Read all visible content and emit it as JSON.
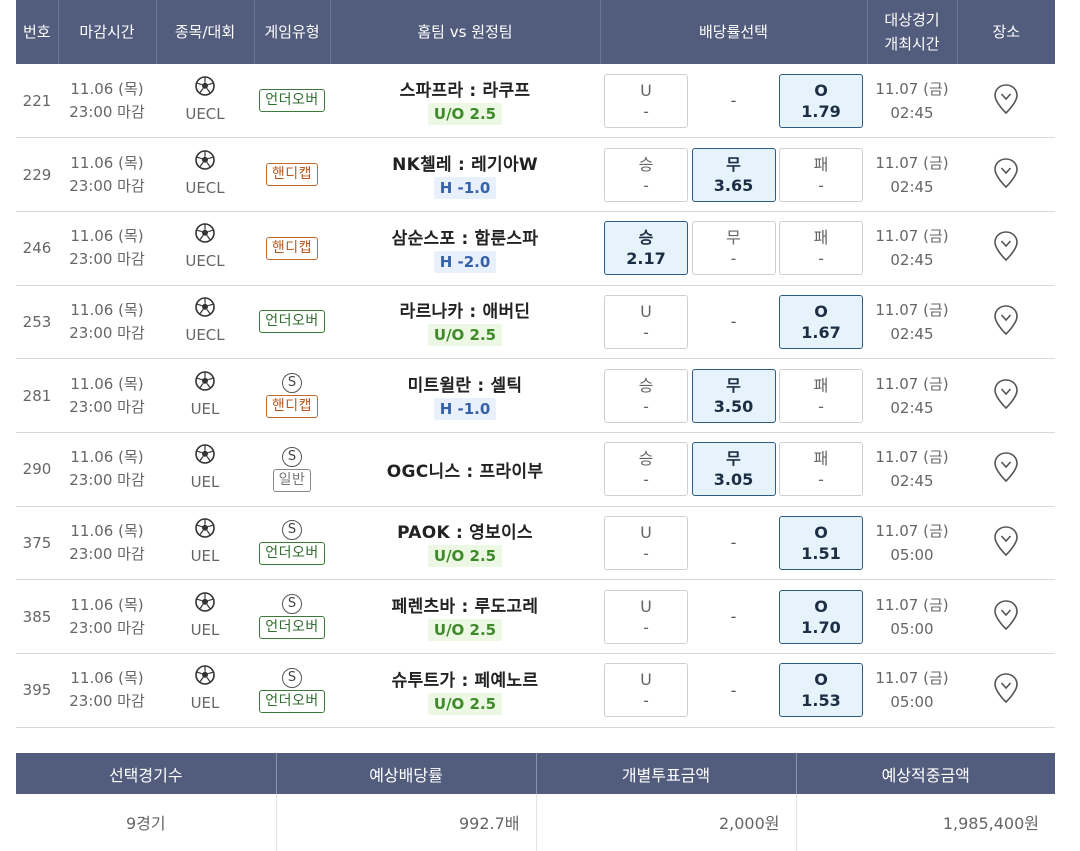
{
  "header": {
    "no": "번호",
    "deadline": "마감시간",
    "sport": "종목/대회",
    "type": "게임유형",
    "match": "홈팀 vs 원정팀",
    "odds": "배당률선택",
    "event_time_1": "대상경기",
    "event_time_2": "개최시간",
    "place": "장소"
  },
  "rows": [
    {
      "no": "221",
      "date": "11.06 (목)",
      "deadline": "23:00 마감",
      "league": "UECL",
      "s": "",
      "type": "언더오버",
      "type_kind": "uo",
      "home": "스파프라",
      "away": "라쿠프",
      "sub": "U/O 2.5",
      "sub_kind": "uo",
      "o1_label": "U",
      "o1_val": "-",
      "o2_label": "-",
      "o2_val": "",
      "o3_label": "O",
      "o3_val": "1.79",
      "sel": 3,
      "mid_dash": true,
      "evt_date": "11.07 (금)",
      "evt_time": "02:45"
    },
    {
      "no": "229",
      "date": "11.06 (목)",
      "deadline": "23:00 마감",
      "league": "UECL",
      "s": "",
      "type": "핸디캡",
      "type_kind": "hc",
      "home": "NK첼레",
      "away": "레기아W",
      "sub": "H -1.0",
      "sub_kind": "hc",
      "o1_label": "승",
      "o1_val": "-",
      "o2_label": "무",
      "o2_val": "3.65",
      "o3_label": "패",
      "o3_val": "-",
      "sel": 2,
      "mid_dash": false,
      "evt_date": "11.07 (금)",
      "evt_time": "02:45"
    },
    {
      "no": "246",
      "date": "11.06 (목)",
      "deadline": "23:00 마감",
      "league": "UECL",
      "s": "",
      "type": "핸디캡",
      "type_kind": "hc",
      "home": "삼순스포",
      "away": "함룬스파",
      "sub": "H -2.0",
      "sub_kind": "hc",
      "o1_label": "승",
      "o1_val": "2.17",
      "o2_label": "무",
      "o2_val": "-",
      "o3_label": "패",
      "o3_val": "-",
      "sel": 1,
      "mid_dash": false,
      "evt_date": "11.07 (금)",
      "evt_time": "02:45"
    },
    {
      "no": "253",
      "date": "11.06 (목)",
      "deadline": "23:00 마감",
      "league": "UECL",
      "s": "",
      "type": "언더오버",
      "type_kind": "uo",
      "home": "라르나카",
      "away": "애버딘",
      "sub": "U/O 2.5",
      "sub_kind": "uo",
      "o1_label": "U",
      "o1_val": "-",
      "o2_label": "-",
      "o2_val": "",
      "o3_label": "O",
      "o3_val": "1.67",
      "sel": 3,
      "mid_dash": true,
      "evt_date": "11.07 (금)",
      "evt_time": "02:45"
    },
    {
      "no": "281",
      "date": "11.06 (목)",
      "deadline": "23:00 마감",
      "league": "UEL",
      "s": "S",
      "type": "핸디캡",
      "type_kind": "hc",
      "home": "미트윌란",
      "away": "셀틱",
      "sub": "H -1.0",
      "sub_kind": "hc",
      "o1_label": "승",
      "o1_val": "-",
      "o2_label": "무",
      "o2_val": "3.50",
      "o3_label": "패",
      "o3_val": "-",
      "sel": 2,
      "mid_dash": false,
      "evt_date": "11.07 (금)",
      "evt_time": "02:45"
    },
    {
      "no": "290",
      "date": "11.06 (목)",
      "deadline": "23:00 마감",
      "league": "UEL",
      "s": "S",
      "type": "일반",
      "type_kind": "nm",
      "home": "OGC니스",
      "away": "프라이부",
      "sub": "",
      "sub_kind": "",
      "o1_label": "승",
      "o1_val": "-",
      "o2_label": "무",
      "o2_val": "3.05",
      "o3_label": "패",
      "o3_val": "-",
      "sel": 2,
      "mid_dash": false,
      "evt_date": "11.07 (금)",
      "evt_time": "02:45"
    },
    {
      "no": "375",
      "date": "11.06 (목)",
      "deadline": "23:00 마감",
      "league": "UEL",
      "s": "S",
      "type": "언더오버",
      "type_kind": "uo",
      "home": "PAOK",
      "away": "영보이스",
      "sub": "U/O 2.5",
      "sub_kind": "uo",
      "o1_label": "U",
      "o1_val": "-",
      "o2_label": "-",
      "o2_val": "",
      "o3_label": "O",
      "o3_val": "1.51",
      "sel": 3,
      "mid_dash": true,
      "evt_date": "11.07 (금)",
      "evt_time": "05:00"
    },
    {
      "no": "385",
      "date": "11.06 (목)",
      "deadline": "23:00 마감",
      "league": "UEL",
      "s": "S",
      "type": "언더오버",
      "type_kind": "uo",
      "home": "페렌츠바",
      "away": "루도고레",
      "sub": "U/O 2.5",
      "sub_kind": "uo",
      "o1_label": "U",
      "o1_val": "-",
      "o2_label": "-",
      "o2_val": "",
      "o3_label": "O",
      "o3_val": "1.70",
      "sel": 3,
      "mid_dash": true,
      "evt_date": "11.07 (금)",
      "evt_time": "05:00"
    },
    {
      "no": "395",
      "date": "11.06 (목)",
      "deadline": "23:00 마감",
      "league": "UEL",
      "s": "S",
      "type": "언더오버",
      "type_kind": "uo",
      "home": "슈투트가",
      "away": "페예노르",
      "sub": "U/O 2.5",
      "sub_kind": "uo",
      "o1_label": "U",
      "o1_val": "-",
      "o2_label": "-",
      "o2_val": "",
      "o3_label": "O",
      "o3_val": "1.53",
      "sel": 3,
      "mid_dash": true,
      "evt_date": "11.07 (금)",
      "evt_time": "05:00"
    }
  ],
  "summary": {
    "h_count": "선택경기수",
    "h_odds": "예상배당률",
    "h_bet": "개별투표금액",
    "h_win": "예상적중금액",
    "count": "9경기",
    "odds": "992.7배",
    "bet": "2,000원",
    "win": "1,985,400원"
  },
  "colors": {
    "header_bg": "#525c7d",
    "selected_bg": "#e6f3fb",
    "uo_green": "#3e8a2a",
    "handicap_orange": "#b85a22",
    "handicap_blue": "#3761a9"
  },
  "icons": {
    "sport": "soccer-ball-icon",
    "place": "map-pin-icon",
    "single": "s-circle-icon"
  }
}
